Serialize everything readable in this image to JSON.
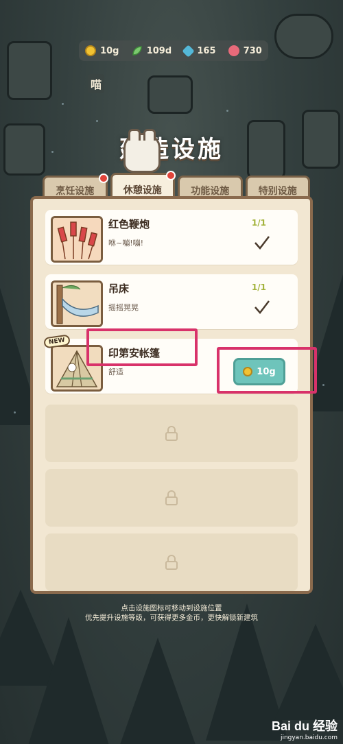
{
  "resources": [
    {
      "icon": "coin-icon",
      "value": "10g"
    },
    {
      "icon": "leaf-icon",
      "value": "109d"
    },
    {
      "icon": "gem-icon",
      "value": "165"
    },
    {
      "icon": "heart-icon",
      "value": "730"
    }
  ],
  "side_label": "喵",
  "title": "建造设施",
  "tabs": [
    {
      "label": "烹饪设施",
      "active": false,
      "has_dot": true
    },
    {
      "label": "休憩设施",
      "active": true,
      "has_dot": true
    },
    {
      "label": "功能设施",
      "active": false,
      "has_dot": false
    },
    {
      "label": "特别设施",
      "active": false,
      "has_dot": false
    }
  ],
  "facilities": [
    {
      "name": "红色鞭炮",
      "desc": "咻~嘣!嘣!",
      "count": "1/1",
      "status": "owned"
    },
    {
      "name": "吊床",
      "desc": "摇摇晃晃",
      "count": "1/1",
      "status": "owned"
    },
    {
      "name": "印第安帐篷",
      "desc": "舒适",
      "badge": "NEW",
      "price": "10g",
      "status": "buy"
    }
  ],
  "footer": {
    "line1": "点击设施图标可移动到设施位置",
    "line2": "优先提升设施等级，可获得更多金币，更快解锁新建筑"
  },
  "watermark": {
    "logo": "Bai du 经验",
    "url": "jingyan.baidu.com"
  },
  "colors": {
    "highlight": "#d8326a",
    "price_button": "#6ec4bb",
    "count_green": "#a3b33c"
  }
}
